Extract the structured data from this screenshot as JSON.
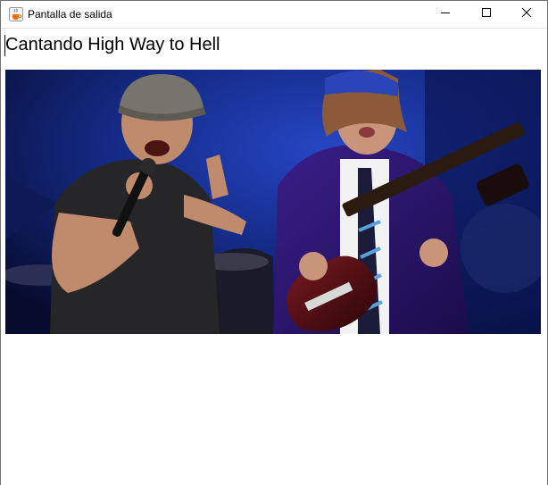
{
  "window": {
    "title": "Pantalla de salida",
    "app_icon": "java-cup-icon",
    "controls": {
      "minimize_icon": "minimize-icon",
      "maximize_icon": "maximize-icon",
      "close_icon": "close-icon"
    }
  },
  "content": {
    "label": "Cantando High Way to Hell",
    "image": {
      "subject": "two rock performers on stage, singer with microphone and flat cap, guitarist with blue cap and cherry-red guitar",
      "colors": {
        "background": "#0b1446",
        "stage_light": "#1d3fb5",
        "guitar": "#5a0f14"
      }
    }
  }
}
